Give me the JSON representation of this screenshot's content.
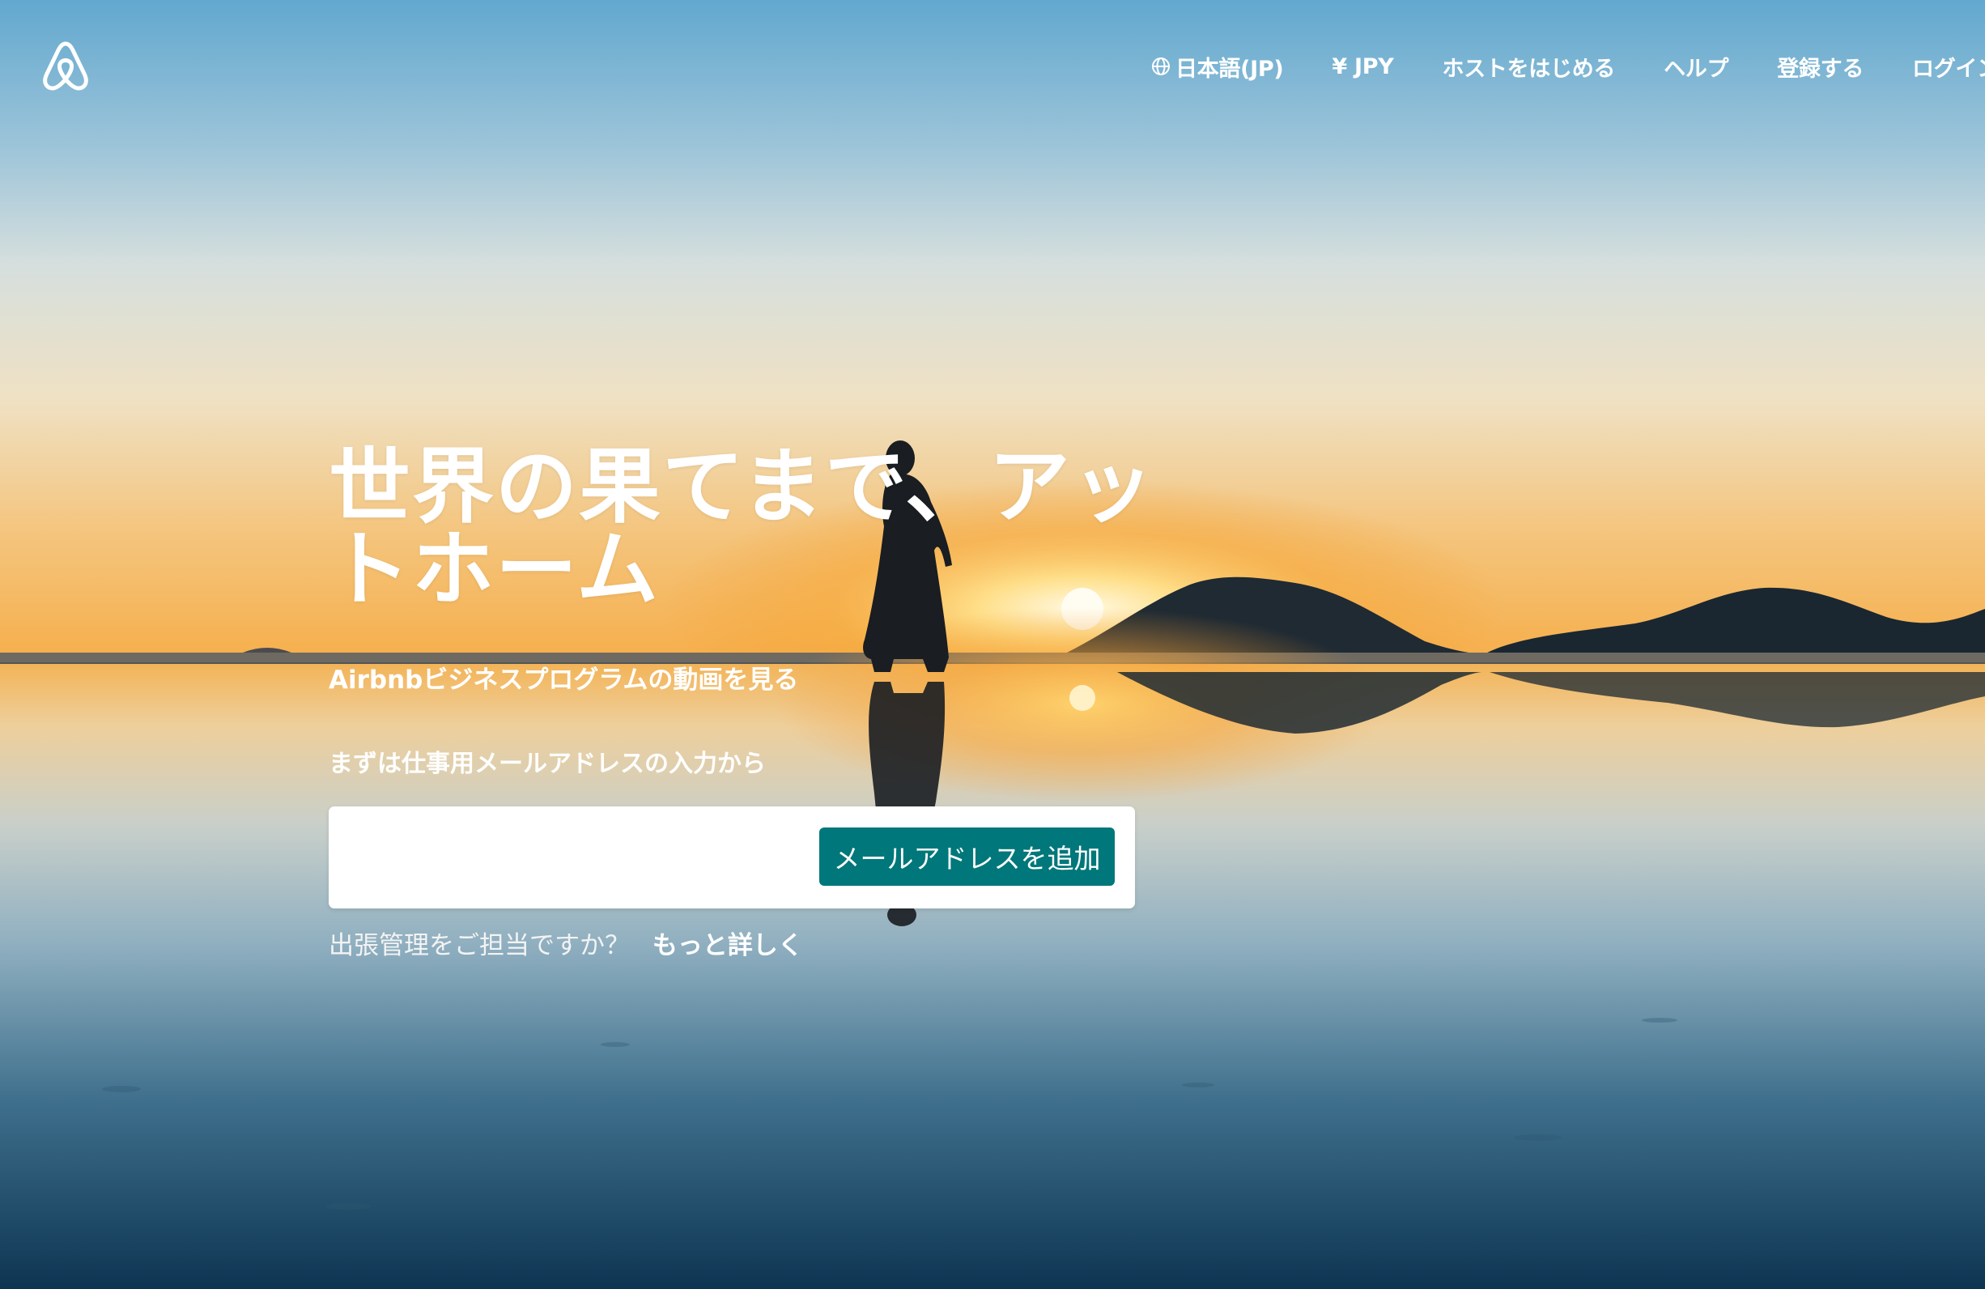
{
  "brand": {
    "logo_icon": "airbnb-belo-icon"
  },
  "nav": {
    "language": {
      "icon": "globe-icon",
      "label": "日本語(JP)"
    },
    "currency": {
      "label": "¥ JPY"
    },
    "host": {
      "label": "ホストをはじめる"
    },
    "help": {
      "label": "ヘルプ"
    },
    "signup": {
      "label": "登録する"
    },
    "login": {
      "label": "ログイン"
    }
  },
  "hero": {
    "title": "世界の果てまで、アットホーム",
    "video_link": "Airbnbビジネスプログラムの動画を見る",
    "prompt": "まずは仕事用メールアドレスの入力から",
    "email": {
      "value": "",
      "placeholder": ""
    },
    "submit_label": "メールアドレスを追加",
    "manager_question": "出張管理をご担当ですか？",
    "learn_more": "もっと詳しく"
  },
  "colors": {
    "accent_button": "#00777a",
    "text_light": "#ffffff"
  }
}
